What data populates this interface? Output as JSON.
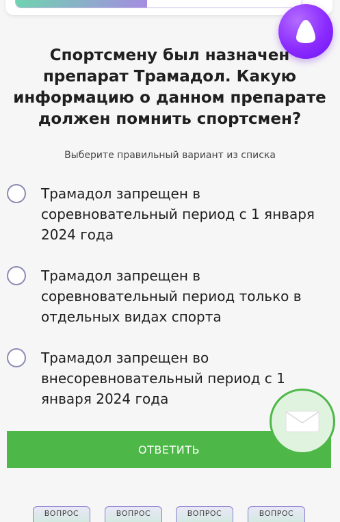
{
  "progress": {
    "fraction": 0.46,
    "accent_start": "#6fd3b0",
    "accent_end": "#a58de0"
  },
  "assistant": {
    "icon": "alice-icon",
    "color": "#8b2bff"
  },
  "question": {
    "text": "Спортсмену был назначен препарат Трамадол. Какую информацию о данном препарате должен помнить спортсмен?",
    "hint": "Выберите правильный вариант из списка"
  },
  "options": [
    {
      "label": "Трамадол запрещен в соревновательный период с 1 января 2024 года",
      "selected": false
    },
    {
      "label": "Трамадол запрещен в соревновательный период только в отдельных видах спорта",
      "selected": false
    },
    {
      "label": "Трамадол запрещен во внесоревновательный период с 1 января 2024 года",
      "selected": false
    }
  ],
  "answer_button": {
    "label": "ОТВЕТИТЬ",
    "color": "#4db848"
  },
  "mail_button": {
    "icon": "envelope-icon"
  },
  "question_tabs": [
    {
      "label": "ВОПРОС"
    },
    {
      "label": "ВОПРОС"
    },
    {
      "label": "ВОПРОС"
    },
    {
      "label": "ВОПРОС"
    }
  ]
}
